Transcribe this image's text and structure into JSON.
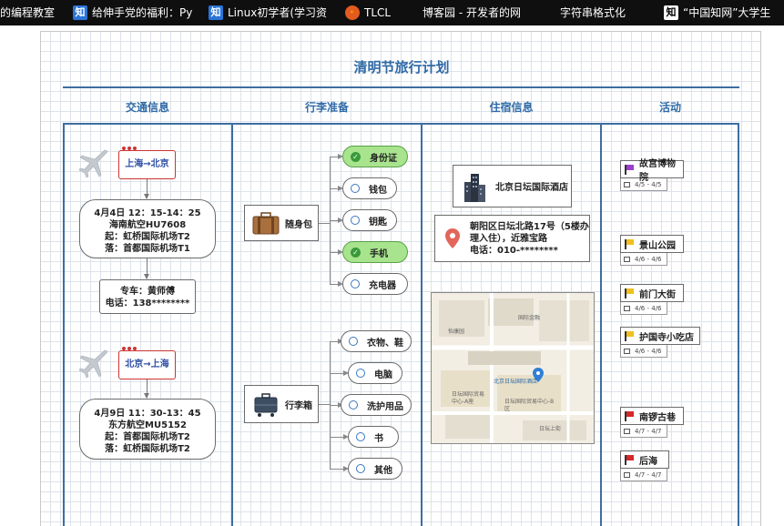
{
  "tabs": [
    {
      "label": "的编程教室",
      "icon": ""
    },
    {
      "label": "给伸手党的福利：Py",
      "icon": "知"
    },
    {
      "label": "Linux初学者(学习资",
      "icon": "知"
    },
    {
      "label": "TLCL",
      "icon": "🔸"
    },
    {
      "label": "博客园 - 开发者的网",
      "icon": ""
    },
    {
      "label": "字符串格式化",
      "icon": ""
    },
    {
      "label": "“中国知网”大学生",
      "icon": "知"
    }
  ],
  "title": "清明节旅行计划",
  "columns": [
    "交通信息",
    "行李准备",
    "住宿信息",
    "活动"
  ],
  "transport": {
    "route1": "上海→北京",
    "flight1": [
      "4月4日 12：15-14：25",
      "海南航空HU7608",
      "起：虹桥国际机场T2",
      "落：首都国际机场T1"
    ],
    "car": [
      "专车：黄师傅",
      "电话：138********"
    ],
    "route2": "北京→上海",
    "flight2": [
      "4月9日 11：30-13：45",
      "东方航空MU5152",
      "起：首都国际机场T2",
      "落：虹桥国际机场T2"
    ]
  },
  "luggage": {
    "bag1_label": "随身包",
    "bag1_items": [
      {
        "label": "身份证",
        "done": true
      },
      {
        "label": "钱包",
        "done": false
      },
      {
        "label": "钥匙",
        "done": false
      },
      {
        "label": "手机",
        "done": true
      },
      {
        "label": "充电器",
        "done": false
      }
    ],
    "bag2_label": "行李箱",
    "bag2_items": [
      {
        "label": "衣物、鞋",
        "done": false
      },
      {
        "label": "电脑",
        "done": false
      },
      {
        "label": "洗护用品",
        "done": false
      },
      {
        "label": "书",
        "done": false
      },
      {
        "label": "其他",
        "done": false
      }
    ]
  },
  "lodging": {
    "hotel": "北京日坛国际酒店",
    "address": [
      "朝阳区日坛北路17号（5楼办",
      "理入住），近雅宝路",
      "电话：010-********"
    ],
    "map_labels": [
      "怡康园",
      "国际金融",
      "日坛国际贸易中心-A座",
      "日坛国际贸易中心-B区",
      "日坛上街",
      "北京日坛国际酒店"
    ]
  },
  "activities": [
    {
      "name": "故宫博物院",
      "date": "4/5 - 4/5",
      "flag": "purple"
    },
    {
      "name": "景山公园",
      "date": "4/6 - 4/6",
      "flag": "yellow"
    },
    {
      "name": "前门大街",
      "date": "4/6 - 4/6",
      "flag": "yellow"
    },
    {
      "name": "护国寺小吃店",
      "date": "4/6 - 4/6",
      "flag": "yellow"
    },
    {
      "name": "南锣古巷",
      "date": "4/7 - 4/7",
      "flag": "red"
    },
    {
      "name": "后海",
      "date": "4/7 - 4/7",
      "flag": "red"
    }
  ]
}
